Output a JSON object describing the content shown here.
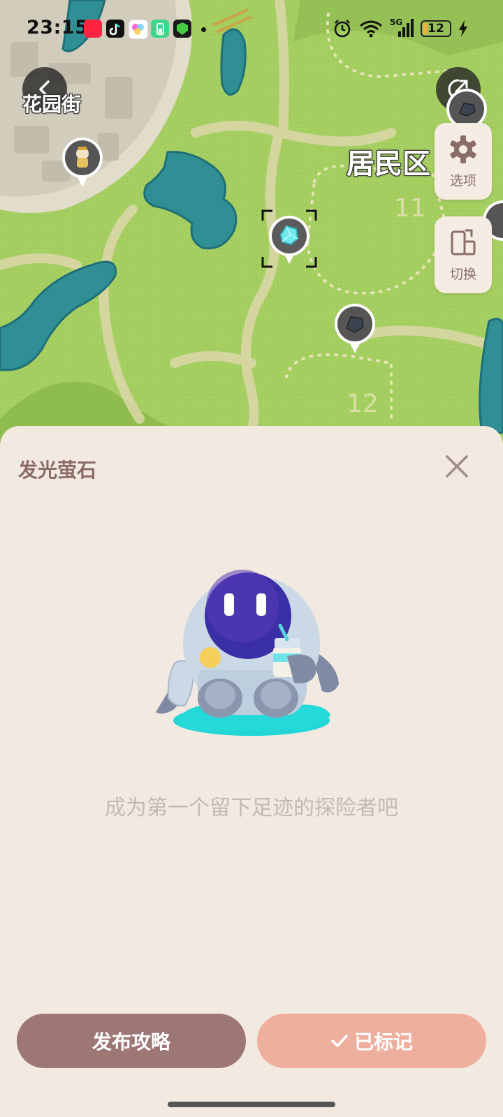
{
  "status_bar": {
    "time": "23:15",
    "network": "5G",
    "battery": "12",
    "app_icons": [
      "xiaohongshu-icon",
      "tiktok-icon",
      "photos-icon",
      "battery-app-icon",
      "shield-app-icon"
    ]
  },
  "map": {
    "labels": {
      "garden_street": "花园街",
      "residential_area": "居民区"
    },
    "zone_numbers": [
      "11",
      "12"
    ],
    "options_label": "选项",
    "switch_label": "切换"
  },
  "sheet": {
    "title": "发光萤石",
    "empty_message": "成为第一个留下足迹的探险者吧",
    "publish_button": "发布攻略",
    "marked_button": "已标记"
  },
  "colors": {
    "sheet_bg": "#f2e9e1",
    "title": "#8b6c69",
    "publish_button": "#9d7774",
    "marked_button": "#efaf9f",
    "map_grass": "#9fcb5e",
    "water": "#2f8f95"
  }
}
